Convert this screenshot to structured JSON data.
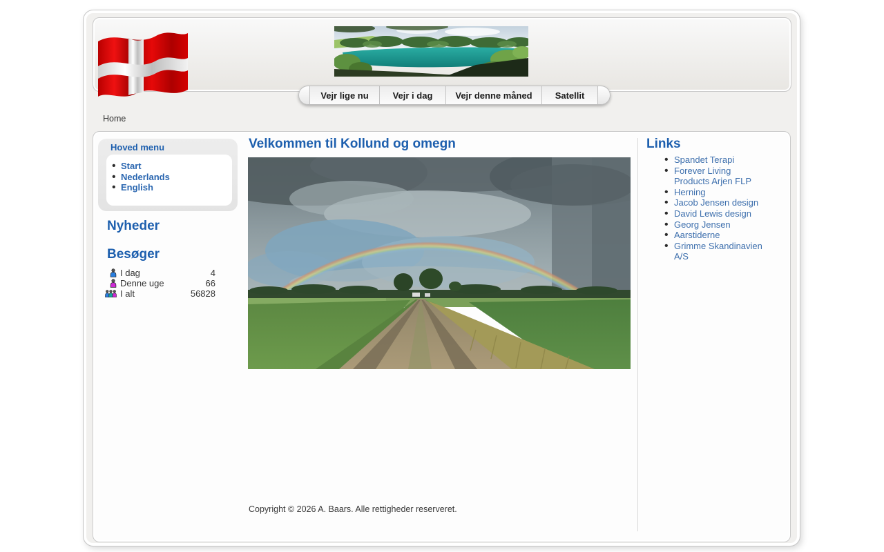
{
  "breadcrumb": {
    "home_label": "Home"
  },
  "header": {
    "flag_icon": "danish-flag",
    "banner_image": "lake-landscape-photo"
  },
  "nav": {
    "tabs": [
      {
        "label": "Vejr lige nu"
      },
      {
        "label": "Vejr i dag"
      },
      {
        "label": "Vejr denne måned"
      },
      {
        "label": "Satellit"
      }
    ]
  },
  "sidebar": {
    "menu_title": "Hoved menu",
    "menu_items": [
      {
        "label": "Start"
      },
      {
        "label": "Nederlands"
      },
      {
        "label": "English"
      }
    ],
    "news_title": "Nyheder",
    "visitors_title": "Besøger",
    "visitor_stats": [
      {
        "icon": "person-blue-icon",
        "label": "I dag",
        "value": "4"
      },
      {
        "icon": "person-magenta-icon",
        "label": "Denne uge",
        "value": "66"
      },
      {
        "icon": "people-group-icon",
        "label": "I alt",
        "value": "56828"
      }
    ]
  },
  "main": {
    "title": "Velkommen til Kollund og omegn",
    "photo": "rainbow-over-country-road-photo",
    "copyright": "Copyright © 2026 A. Baars. Alle rettigheder reserveret."
  },
  "links_panel": {
    "title": "Links",
    "items": [
      {
        "label": "Spandet Terapi"
      },
      {
        "label": "Forever Living Products Arjen FLP"
      },
      {
        "label": "Herning"
      },
      {
        "label": "Jacob Jensen design"
      },
      {
        "label": "David Lewis design"
      },
      {
        "label": "Georg Jensen"
      },
      {
        "label": "Aarstiderne"
      },
      {
        "label": "Grimme Skandinavien A/S"
      }
    ]
  },
  "colors": {
    "accent_blue": "#1d5fae",
    "link_blue": "#3d6fad",
    "stat_person_blue": "#2a7fe0",
    "stat_person_magenta": "#cc2bd4",
    "stat_person_teal": "#16a79c",
    "flag_red": "#d40000"
  }
}
